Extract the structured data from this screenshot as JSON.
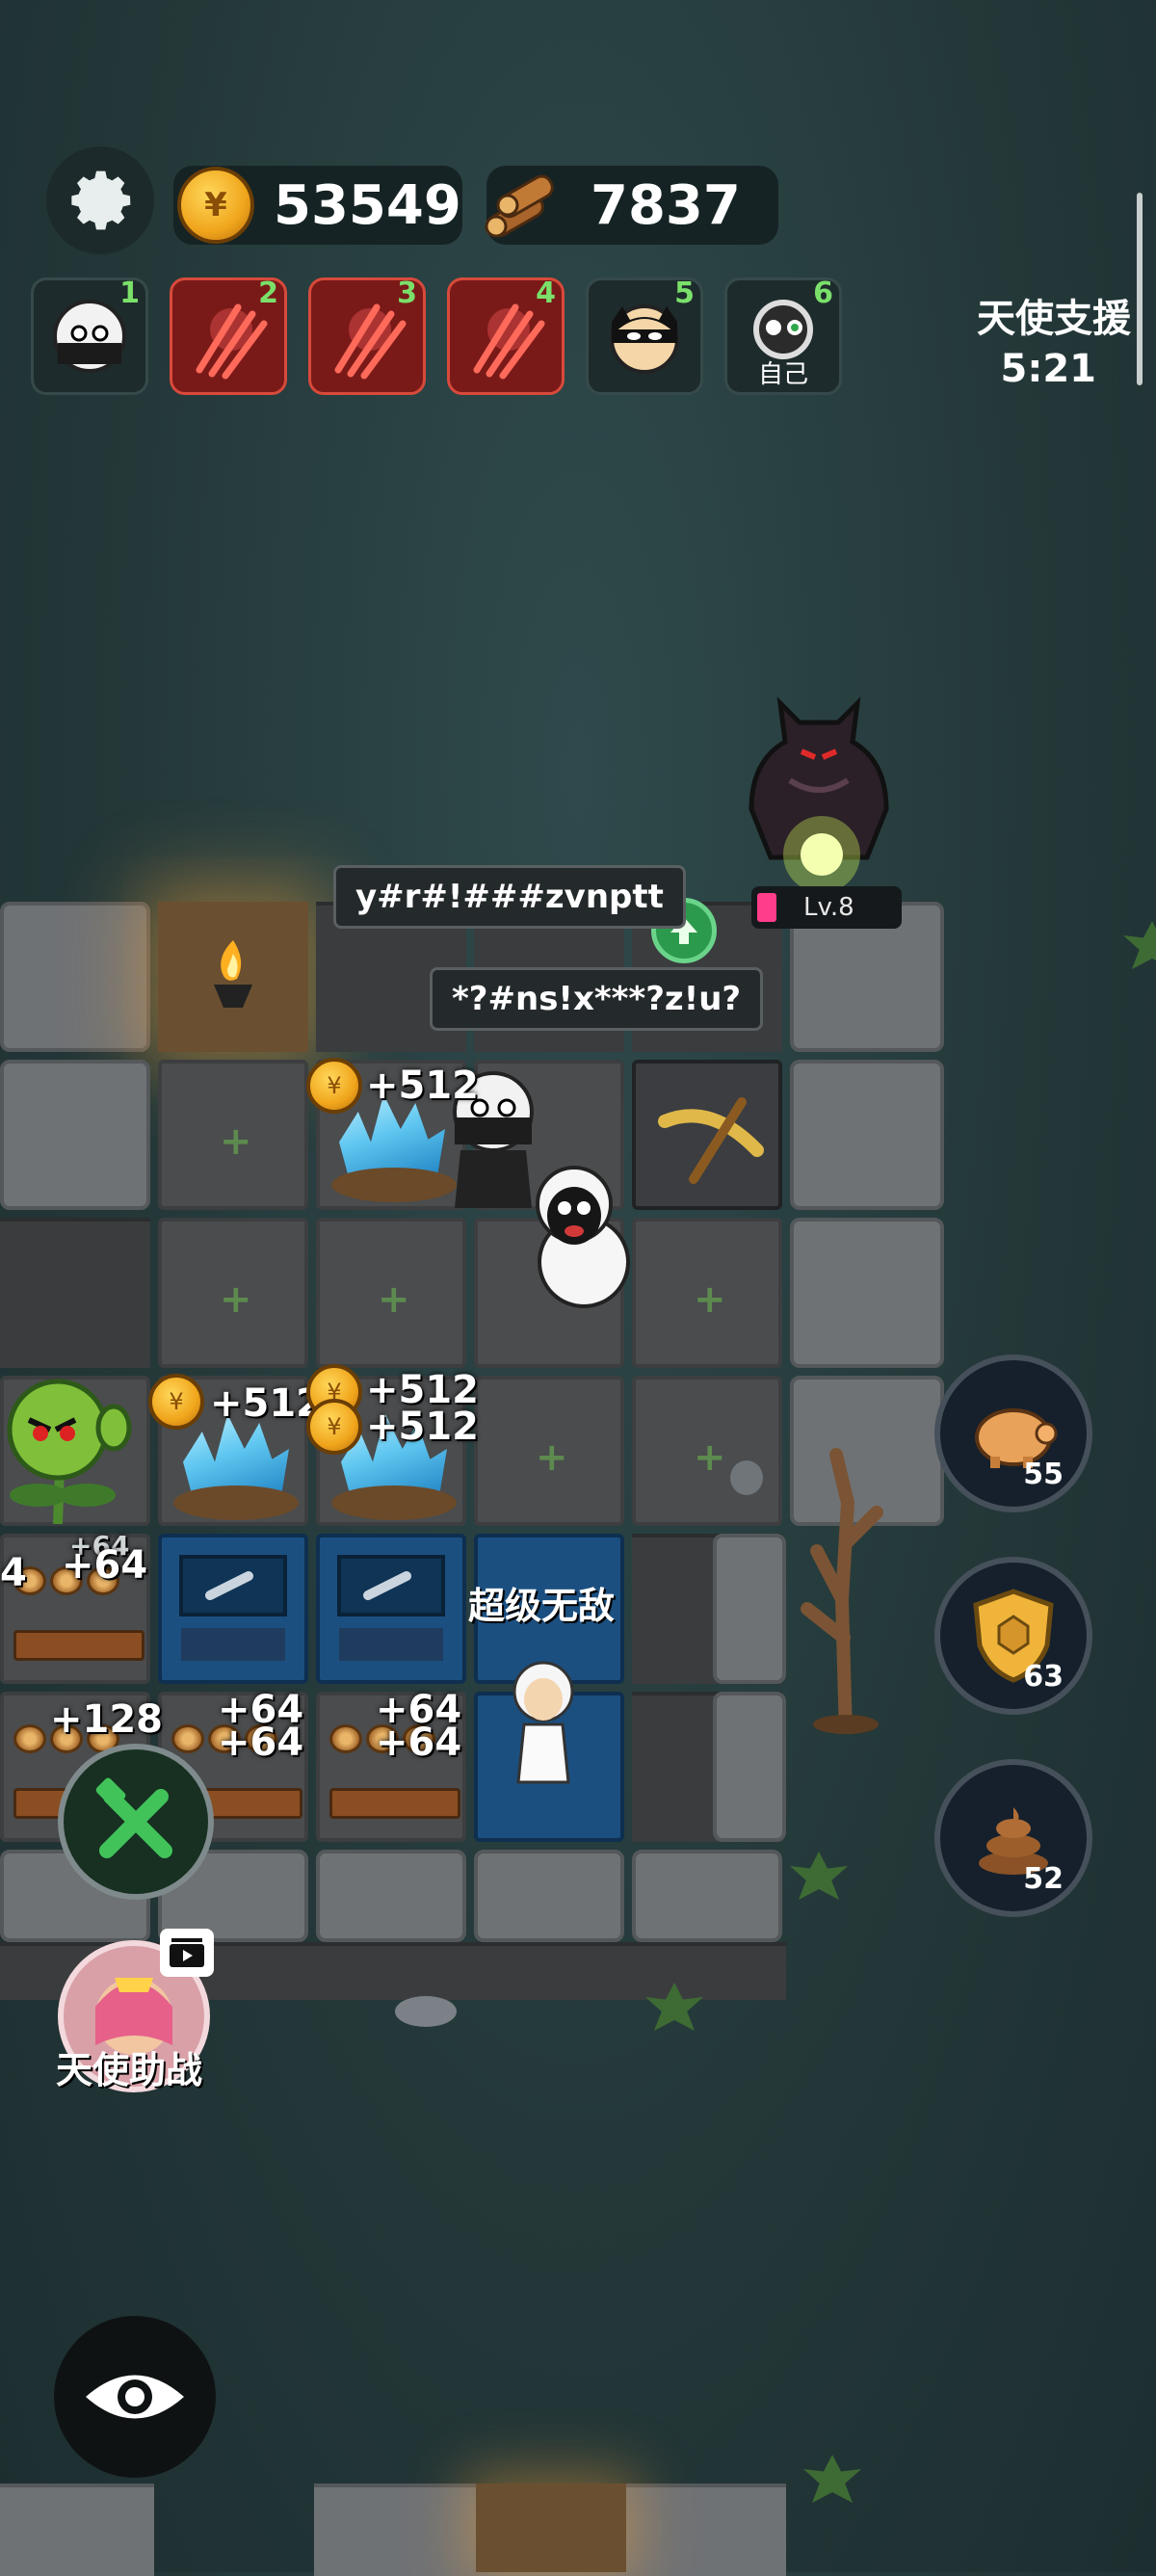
{
  "resources": {
    "coins": "53549",
    "wood": "7837"
  },
  "players": [
    {
      "num": "1",
      "label": "",
      "state": "alive",
      "icon": "sheep-ninja-avatar"
    },
    {
      "num": "2",
      "label": "",
      "state": "dead",
      "icon": "claw-slash"
    },
    {
      "num": "3",
      "label": "",
      "state": "dead",
      "icon": "claw-slash"
    },
    {
      "num": "4",
      "label": "",
      "state": "dead",
      "icon": "claw-slash"
    },
    {
      "num": "5",
      "label": "",
      "state": "alive",
      "icon": "masked-hero-avatar"
    },
    {
      "num": "6",
      "label": "自己",
      "state": "alive",
      "icon": "sheep-self-avatar"
    }
  ],
  "angel_support": {
    "title": "天使支援",
    "timer": "5:21"
  },
  "enemy": {
    "level": "Lv.8"
  },
  "chat_bubbles": {
    "one": "y#r#!###zvnptt",
    "two": "*?#ns!x***?z!u?"
  },
  "gains": {
    "crystal_top": "+512",
    "crystal_left": "+512",
    "crystal_mid_a": "+512",
    "crystal_mid_b": "+512",
    "wood_left": "+64",
    "wood_left_small": "+64",
    "wood_left_cut": "4",
    "wood_bottom_left": "+128",
    "wood_b2a": "+64",
    "wood_b2b": "+64",
    "wood_b3a": "+64",
    "wood_b3b": "+64"
  },
  "player_name_tag": "超级无敌",
  "side_buttons": [
    {
      "icon": "piggy-bank-icon",
      "count": "55"
    },
    {
      "icon": "shield-icon",
      "count": "63"
    },
    {
      "icon": "poop-icon",
      "count": "52"
    }
  ],
  "angel_help_label": "天使助战",
  "colors": {
    "background": "#243839",
    "accent_green": "#7be06a",
    "dead_red": "#7a1a18",
    "coin_gold": "#f0a51c"
  }
}
